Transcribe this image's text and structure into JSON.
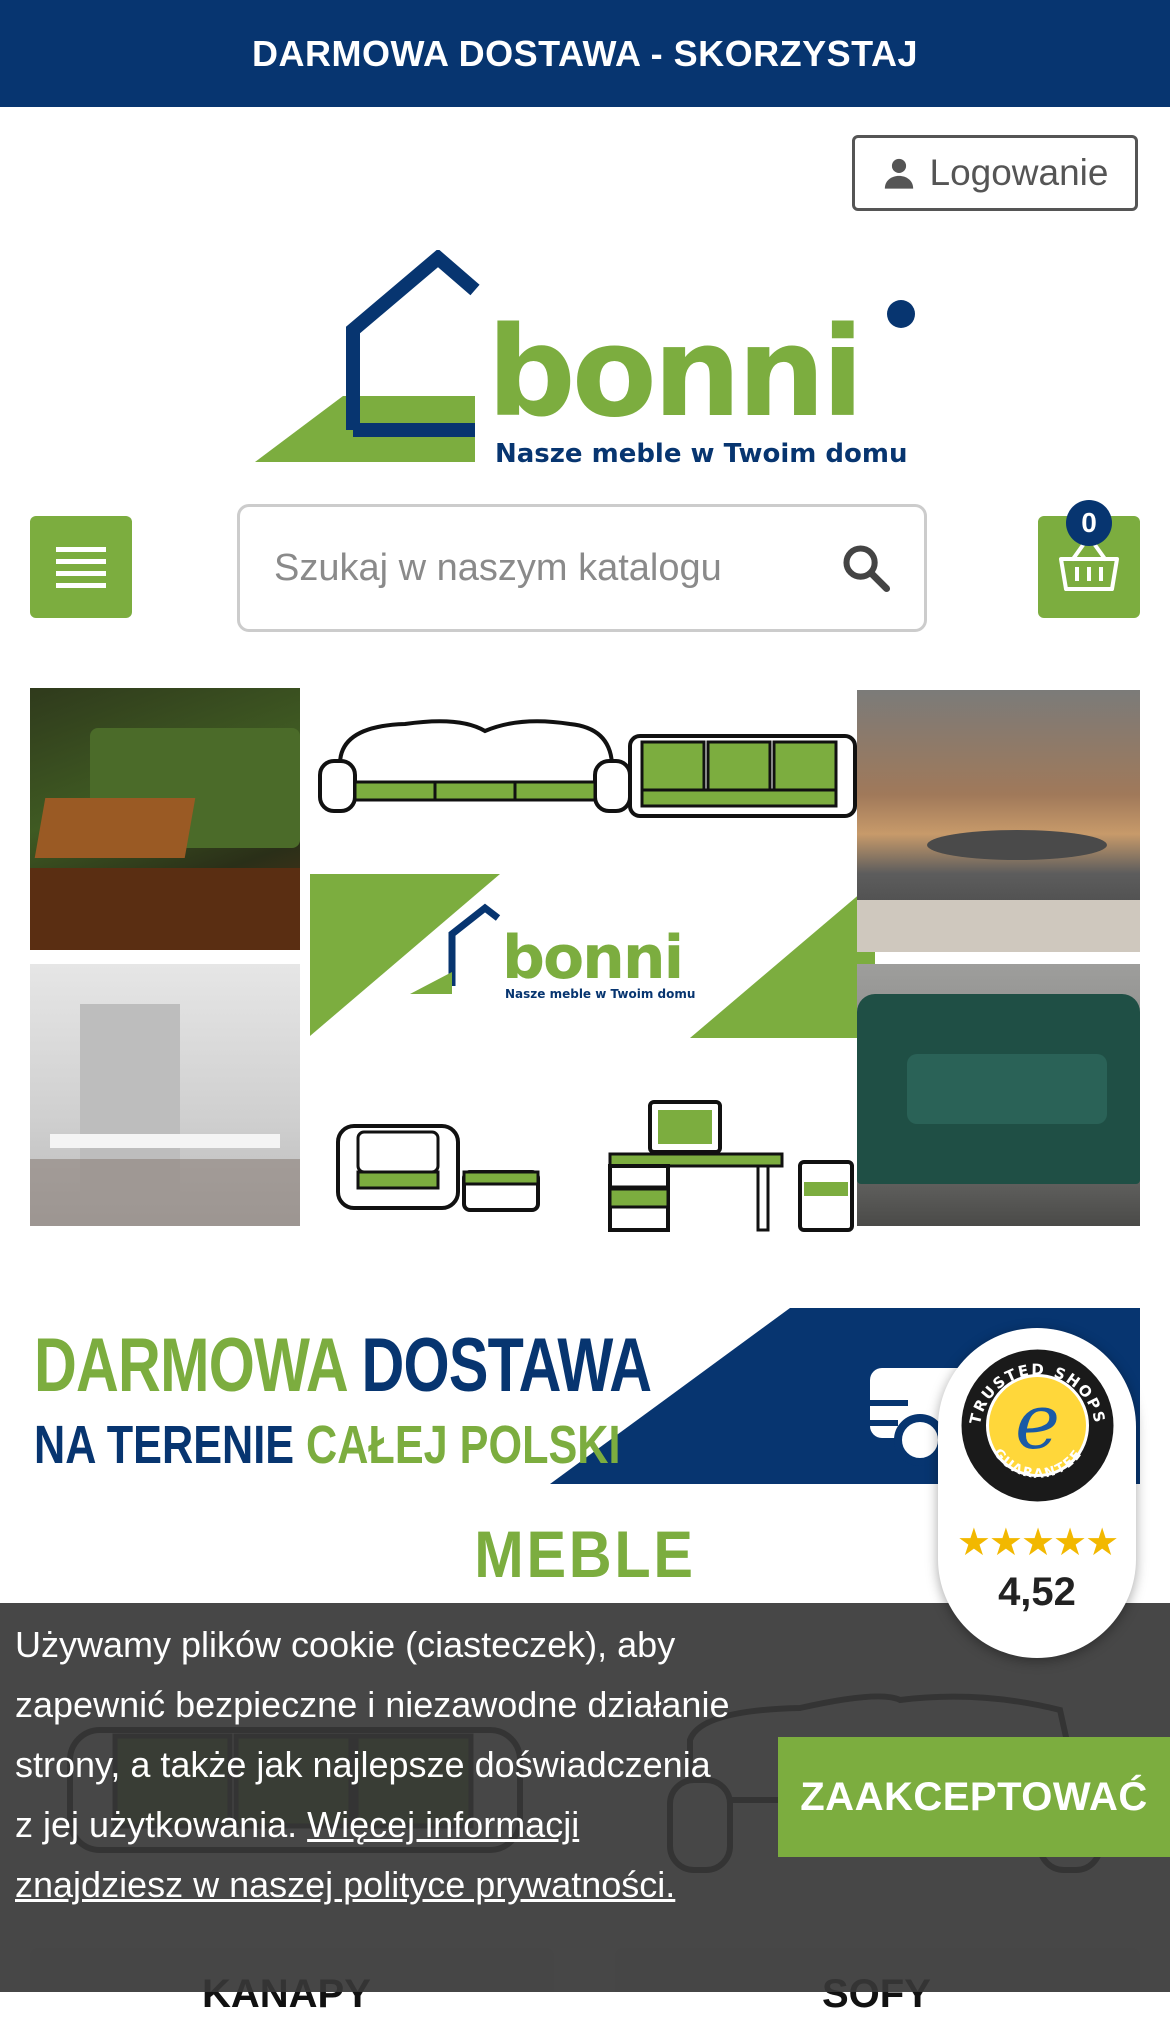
{
  "topbar": {
    "promo_text": "DARMOWA DOSTAWA - SKORZYSTAJ"
  },
  "header": {
    "login_label": "Logowanie",
    "logo": {
      "name": "bonni",
      "tagline": "Nasze meble w Twoim domu"
    },
    "search": {
      "placeholder": "Szukaj w naszym katalogu"
    },
    "cart": {
      "count": "0"
    }
  },
  "hero": {
    "logo_name": "bonni",
    "logo_tagline": "Nasze meble w Twoim domu"
  },
  "delivery_banner": {
    "line1_green": "DARMOWA",
    "line1_blue": "DOSTAWA",
    "line2_blue": "NA TERENIE",
    "line2_green": "CAŁEJ POLSKI"
  },
  "section": {
    "title": "MEBLE"
  },
  "categories": [
    {
      "label": "KANAPY"
    },
    {
      "label": "SOFY"
    }
  ],
  "trusted_shops": {
    "stars": "★★★★★",
    "rating": "4,52"
  },
  "cookie": {
    "text": "Używamy plików cookie (ciasteczek), aby zapewnić bezpieczne i niezawodne działanie strony, a także jak najlepsze doświadczenia z jej użytkowania. ",
    "link": "Więcej informacji znajdziesz w naszej polityce prywatności.",
    "accept_label": "ZAAKCEPTOWAĆ"
  },
  "colors": {
    "brand_blue": "#073570",
    "brand_green": "#7cad3f",
    "cookie_bg": "#373737"
  }
}
